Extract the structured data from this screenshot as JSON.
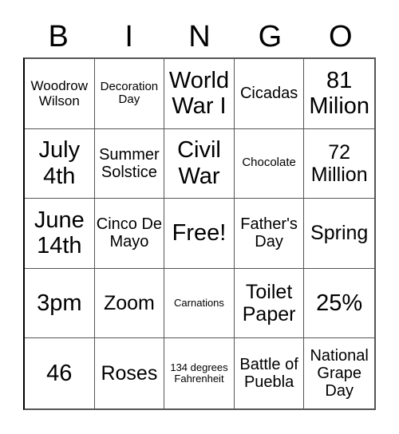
{
  "header": [
    "B",
    "I",
    "N",
    "G",
    "O"
  ],
  "cells": [
    "Woodrow Wilson",
    "Decoration Day",
    "World War I",
    "Cicadas",
    "81 Milion",
    "July 4th",
    "Summer Solstice",
    "Civil War",
    "Chocolate",
    "72 Million",
    "June 14th",
    "Cinco De Mayo",
    "Free!",
    "Father's Day",
    "Spring",
    "3pm",
    "Zoom",
    "Carnations",
    "Toilet Paper",
    "25%",
    "46",
    "Roses",
    "134 degrees Fahrenheit",
    "Battle of Puebla",
    "National Grape Day"
  ]
}
